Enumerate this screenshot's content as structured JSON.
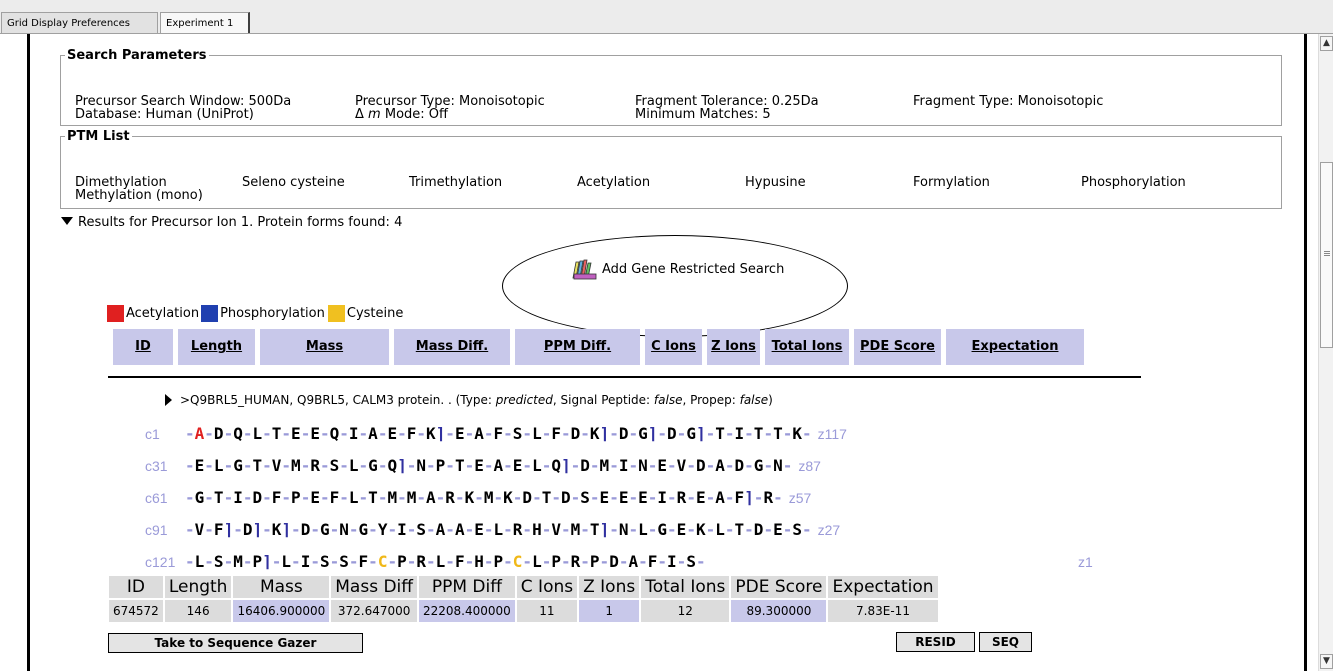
{
  "tabs": [
    {
      "label": "Grid Display Preferences"
    },
    {
      "label": "Experiment 1"
    }
  ],
  "search_parameters": {
    "title": "Search Parameters",
    "precursor_window": "Precursor Search Window: 500Da",
    "database": "Database: Human (UniProt)",
    "precursor_type": "Precursor Type: Monoisotopic",
    "delta_symbol": "Δ",
    "delta_m": "m",
    "delta_mode": " Mode: Off",
    "fragment_tolerance": "Fragment Tolerance: 0.25Da",
    "minimum_matches": "Minimum Matches: 5",
    "fragment_type": "Fragment Type: Monoisotopic"
  },
  "ptm_list": {
    "title": "PTM List",
    "items": [
      "Dimethylation",
      "Seleno cysteine",
      "Trimethylation",
      "Acetylation",
      "Hypusine",
      "Formylation",
      "Phosphorylation",
      "Methylation (mono)"
    ]
  },
  "results_title": "Results for Precursor Ion 1. Protein forms found: 4",
  "gene_search_label": "Add Gene Restricted Search",
  "legend": {
    "items": [
      {
        "label": "Acetylation",
        "color": "#e02020"
      },
      {
        "label": "Phosphorylation",
        "color": "#2040b0"
      },
      {
        "label": "Cysteine",
        "color": "#f0c020"
      }
    ]
  },
  "column_headers": [
    "ID",
    "Length",
    "Mass",
    "Mass Diff.",
    "PPM Diff.",
    "C Ions",
    "Z Ions",
    "Total Ions",
    "PDE Score",
    "Expectation"
  ],
  "protein": {
    "accession": ">Q9BRL5_HUMAN, Q9BRL5, CALM3 protein. . (Type: ",
    "type": "predicted",
    "signal_label": ", Signal Peptide: ",
    "signal": "false",
    "propep_label": ", Propep: ",
    "propep": "false",
    "close": ")"
  },
  "sequence_rows": [
    {
      "c": "c1",
      "z": "z117",
      "aa": [
        "A",
        "D",
        "Q",
        "L",
        "T",
        "E",
        "E",
        "Q",
        "I",
        "A",
        "E",
        "F",
        "K",
        "E",
        "A",
        "F",
        "S",
        "L",
        "F",
        "D",
        "K",
        "D",
        "G",
        "D",
        "G",
        "T",
        "I",
        "T",
        "T",
        "K"
      ],
      "cut": [
        12,
        20,
        22,
        24
      ],
      "ac": [
        0
      ],
      "cy": []
    },
    {
      "c": "c31",
      "z": "z87",
      "aa": [
        "E",
        "L",
        "G",
        "T",
        "V",
        "M",
        "R",
        "S",
        "L",
        "G",
        "Q",
        "N",
        "P",
        "T",
        "E",
        "A",
        "E",
        "L",
        "Q",
        "D",
        "M",
        "I",
        "N",
        "E",
        "V",
        "D",
        "A",
        "D",
        "G",
        "N"
      ],
      "cut": [
        10,
        18
      ],
      "ac": [],
      "cy": []
    },
    {
      "c": "c61",
      "z": "z57",
      "aa": [
        "G",
        "T",
        "I",
        "D",
        "F",
        "P",
        "E",
        "F",
        "L",
        "T",
        "M",
        "M",
        "A",
        "R",
        "K",
        "M",
        "K",
        "D",
        "T",
        "D",
        "S",
        "E",
        "E",
        "E",
        "I",
        "R",
        "E",
        "A",
        "F",
        "R"
      ],
      "cut": [
        28
      ],
      "ac": [],
      "cy": []
    },
    {
      "c": "c91",
      "z": "z27",
      "aa": [
        "V",
        "F",
        "D",
        "K",
        "D",
        "G",
        "N",
        "G",
        "Y",
        "I",
        "S",
        "A",
        "A",
        "E",
        "L",
        "R",
        "H",
        "V",
        "M",
        "T",
        "N",
        "L",
        "G",
        "E",
        "K",
        "L",
        "T",
        "D",
        "E",
        "S"
      ],
      "cut": [
        1,
        2,
        3,
        19
      ],
      "ac": [],
      "cy": []
    },
    {
      "c": "c121",
      "z": "z1",
      "aa": [
        "L",
        "S",
        "M",
        "P",
        "L",
        "I",
        "S",
        "S",
        "F",
        "C",
        "P",
        "R",
        "L",
        "F",
        "H",
        "P",
        "C",
        "L",
        "P",
        "R",
        "P",
        "D",
        "A",
        "F",
        "I",
        "S"
      ],
      "cut": [
        3
      ],
      "ac": [],
      "cy": [
        9,
        16
      ]
    }
  ],
  "result_headers": [
    "ID",
    "Length",
    "Mass",
    "Mass Diff",
    "PPM Diff",
    "C Ions",
    "Z Ions",
    "Total Ions",
    "PDE Score",
    "Expectation"
  ],
  "result_values": [
    "674572",
    "146",
    "16406.900000",
    "372.647000",
    "22208.400000",
    "11",
    "1",
    "12",
    "89.300000",
    "7.83E-11"
  ],
  "buttons": {
    "sequence_gazer": "Take to Sequence Gazer",
    "resid": "RESID",
    "seq": "SEQ"
  }
}
